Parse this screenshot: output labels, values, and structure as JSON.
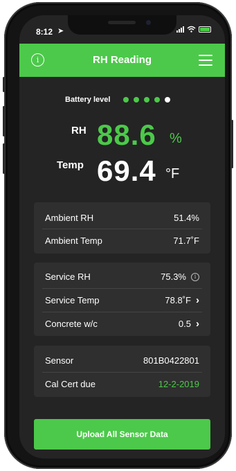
{
  "status_bar": {
    "time": "8:12",
    "battery_color": "#4fd04a"
  },
  "header": {
    "title": "RH Reading",
    "info_icon": "info-icon",
    "menu_icon": "hamburger-menu-icon",
    "color": "#4cc94a"
  },
  "battery": {
    "label": "Battery level",
    "level": 4,
    "max": 5
  },
  "readings": {
    "rh": {
      "label": "RH",
      "value": "88.6",
      "unit": "%"
    },
    "temp": {
      "label": "Temp",
      "value": "69.4",
      "unit": "°F"
    }
  },
  "ambient": [
    {
      "label": "Ambient RH",
      "value": "51.4%"
    },
    {
      "label": "Ambient Temp",
      "value": "71.7˚F"
    }
  ],
  "service": [
    {
      "label": "Service RH",
      "value": "75.3%",
      "icon": "info-icon"
    },
    {
      "label": "Service Temp",
      "value": "78.8˚F",
      "icon": "chevron-right-icon"
    },
    {
      "label": "Concrete w/c",
      "value": "0.5",
      "icon": "chevron-right-icon"
    }
  ],
  "sensor": [
    {
      "label": "Sensor",
      "value": "801B0422801"
    },
    {
      "label": "Cal Cert due",
      "value": "12-2-2019",
      "value_color": "#4cc94a"
    }
  ],
  "upload_button": {
    "label": "Upload All Sensor Data"
  },
  "colors": {
    "accent": "#4cc94a",
    "background": "#242424",
    "card": "#2f2f2f"
  }
}
